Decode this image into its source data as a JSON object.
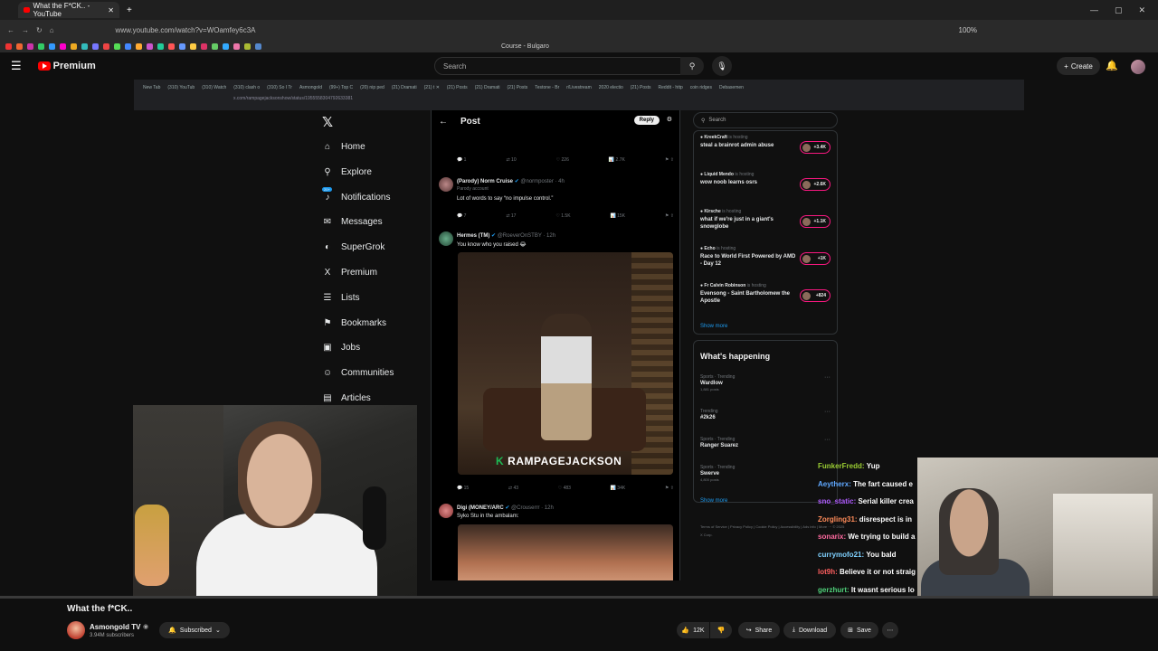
{
  "browser": {
    "tab_title": "What the F*CK.. - YouTube",
    "url": "www.youtube.com/watch?v=WOamfey6c3A",
    "zoom": "100%",
    "bookmark_label": "Course - Bulgaro"
  },
  "youtube": {
    "brand": "Premium",
    "search_placeholder": "Search",
    "create_label": "Create"
  },
  "inner_browser": {
    "tabs": [
      "New Tab",
      "(310) YouTub",
      "(310) Watch",
      "(310) clash o",
      "(310) So I Tr",
      "Asmongold",
      "(99+) Top C",
      "(20) nip ped",
      "(21) Dramati",
      "(21) t ✕",
      "(21) Posts",
      "(21) Dramati",
      "(21) Posts",
      "Testone - Br",
      "r/Livestream",
      "2020 electio",
      "(21) Posts",
      "Reddit - http",
      "coin ridges",
      "Debasemen"
    ],
    "address": "x.com/rampagejacksonshow/status/1955558304792633381"
  },
  "x_nav": {
    "items": [
      {
        "label": "Home",
        "icon": "⌂",
        "icon_name": "home-icon"
      },
      {
        "label": "Explore",
        "icon": "⚲",
        "icon_name": "search-icon"
      },
      {
        "label": "Notifications",
        "icon": "♪",
        "icon_name": "bell-icon",
        "badge": "20+"
      },
      {
        "label": "Messages",
        "icon": "✉",
        "icon_name": "mail-icon"
      },
      {
        "label": "SuperGrok",
        "icon": "◐",
        "icon_name": "grok-icon"
      },
      {
        "label": "Premium",
        "icon": "X",
        "icon_name": "x-premium-icon"
      },
      {
        "label": "Lists",
        "icon": "☰",
        "icon_name": "list-icon"
      },
      {
        "label": "Bookmarks",
        "icon": "⚑",
        "icon_name": "bookmark-icon"
      },
      {
        "label": "Jobs",
        "icon": "▣",
        "icon_name": "briefcase-icon"
      },
      {
        "label": "Communities",
        "icon": "☺",
        "icon_name": "communities-icon"
      },
      {
        "label": "Articles",
        "icon": "▤",
        "icon_name": "article-icon"
      }
    ]
  },
  "feed": {
    "title": "Post",
    "reply_label": "Reply",
    "row0": {
      "replies": "1",
      "reposts": "10",
      "likes": "226",
      "views": "2.7K"
    },
    "tweets": [
      {
        "name": "(Parody) Norm Cruise",
        "handle": "@normposter · 4h",
        "tag": "Parody account",
        "text": "Lot of words to say “no impulse control.”",
        "replies": "7",
        "reposts": "17",
        "likes": "1.5K",
        "views": "15K"
      },
      {
        "name": "Hermes (TM)",
        "handle": "@RoeverOnSTBY · 12h",
        "text": "You know who you raised 😂",
        "watermark": "RAMPAGEJACKSON",
        "replies": "15",
        "reposts": "43",
        "likes": "483",
        "views": "34K"
      },
      {
        "name": "Digi (MONEY/ARC",
        "handle": "@Crouserrr · 12h",
        "text": "Syko Stu in the ambalam:"
      }
    ]
  },
  "right": {
    "search_placeholder": "Search",
    "spaces": [
      {
        "host": "KreekCraft",
        "title": "steal a brainrot admin abuse",
        "count": "+3.4K"
      },
      {
        "host": "Liquid Mendo",
        "title": "wow noob learns osrs",
        "count": "+2.6K"
      },
      {
        "host": "Kirsche",
        "title": "what if we're just in a giant's snowglobe",
        "count": "+1.1K"
      },
      {
        "host": "Echo",
        "title": "Race to World First Powered by AMD - Day 12",
        "count": "+1K"
      },
      {
        "host": "Fr Calvin Robinson",
        "title": "Evensong - Saint Bartholomew the Apostle",
        "count": "+824"
      }
    ],
    "hosting_label": "is hosting",
    "show_more": "Show more",
    "happening_title": "What's happening",
    "trends": [
      {
        "category": "Sports · Trending",
        "name": "Wardlow",
        "count": "1,881 posts"
      },
      {
        "category": "Trending",
        "name": "#2k26",
        "count": ""
      },
      {
        "category": "Sports · Trending",
        "name": "Ranger Suarez",
        "count": ""
      },
      {
        "category": "Sports · Trending",
        "name": "Swerve",
        "count": "4,800 posts"
      }
    ],
    "footer": "Terms of Service  |  Privacy Policy  |  Cookie Policy  |  Accessibility  |  Ads info  |  More ···  © 2025 X Corp."
  },
  "chat": [
    {
      "user": "FunkerFredd:",
      "msg": "Yup",
      "color": "#9acd32"
    },
    {
      "user": "Aeytherx:",
      "msg": "The fart caused e",
      "color": "#5fa8ff"
    },
    {
      "user": "sno_static:",
      "msg": "Serial killer crea",
      "color": "#b05cff"
    },
    {
      "user": "Zorgling31:",
      "msg": "disrespect is in",
      "color": "#ff8c5a"
    },
    {
      "user": "sonarix:",
      "msg": "We trying to build a",
      "color": "#ff6aa0"
    },
    {
      "user": "currymofo21:",
      "msg": "You bald",
      "color": "#7fd1ff"
    },
    {
      "user": "lot9h:",
      "msg": "Believe it or not straig",
      "color": "#ff5f5f"
    },
    {
      "user": "gerzhurt:",
      "msg": "It wasnt serious lo",
      "color": "#4fd17a"
    }
  ],
  "video": {
    "title": "What the f*CK..",
    "channel": "Asmongold TV",
    "subscribers": "3.94M subscribers",
    "subscribed_label": "Subscribed",
    "likes": "12K",
    "share_label": "Share",
    "download_label": "Download",
    "save_label": "Save"
  }
}
